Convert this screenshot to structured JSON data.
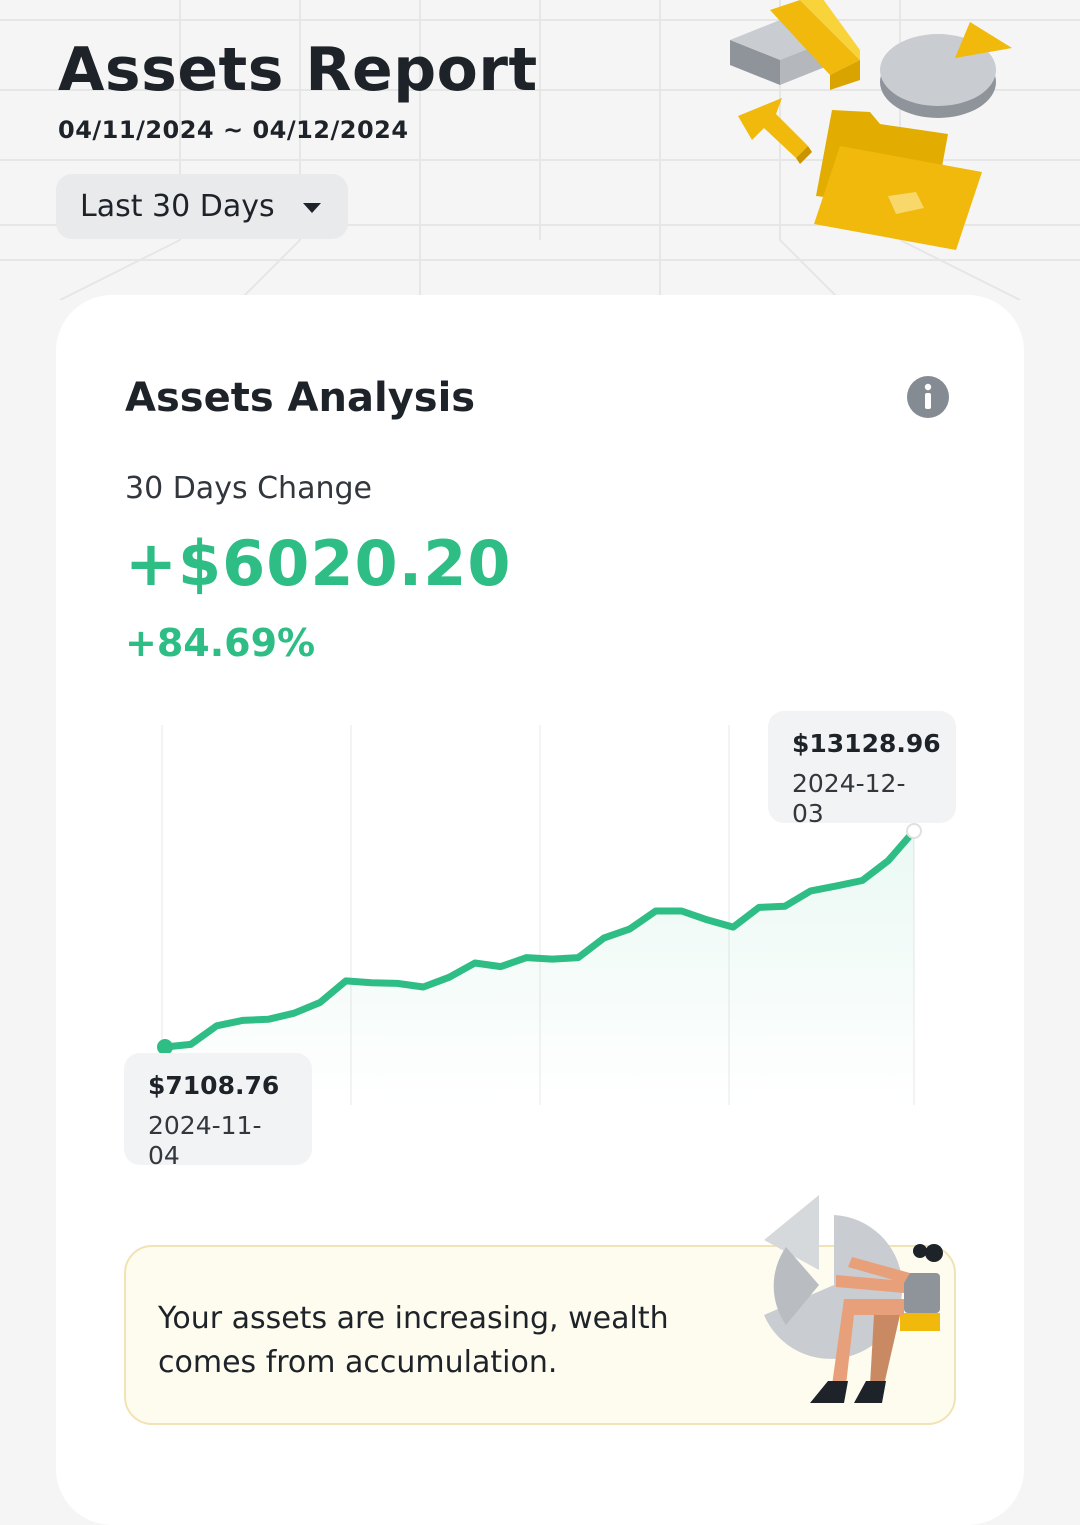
{
  "header": {
    "title": "Assets Report",
    "date_range": "04/11/2024 ~ 04/12/2024",
    "period_select": {
      "selected": "Last 30 Days"
    }
  },
  "card": {
    "title": "Assets Analysis",
    "change_label": "30 Days Change",
    "change_amount": "+$6020.20",
    "change_percent": "+84.69%",
    "accent_color": "#2ebd85"
  },
  "chart_data": {
    "type": "area",
    "x_start": "2024-11-04",
    "x_end": "2024-12-03",
    "values": [
      7108.76,
      7180,
      7700,
      7850,
      7880,
      8050,
      8350,
      8950,
      8900,
      8880,
      8780,
      9050,
      9450,
      9350,
      9600,
      9560,
      9600,
      10150,
      10400,
      10900,
      10900,
      10650,
      10450,
      11000,
      11030,
      11460,
      11600,
      11750,
      12300,
      13128.96
    ],
    "start_label": {
      "value": "$7108.76",
      "date": "2024-11-04"
    },
    "end_label": {
      "value": "$13128.96",
      "date": "2024-12-03"
    },
    "grid": true,
    "line_color": "#2ebd85"
  },
  "insight": {
    "text": "Your assets are increasing, wealth comes from accumulation."
  },
  "icons": [
    "caret-down-icon",
    "info-icon",
    "report-illustration",
    "pie-chart-person-illustration"
  ]
}
